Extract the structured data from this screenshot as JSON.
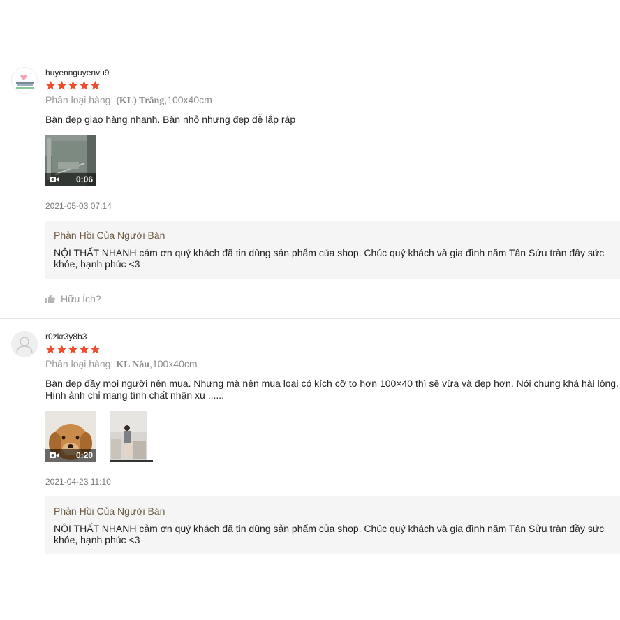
{
  "reviews": [
    {
      "username": "huyennguyenvu9",
      "rating": 5,
      "variant": {
        "label": "Phân loại hàng: ",
        "value": "(KL) Trắng",
        "size": ",100x40cm"
      },
      "comment": "Bàn đẹp giao hàng nhanh. Bàn nhỏ nhưng đẹp dễ lắp ráp",
      "media": [
        {
          "type": "video",
          "duration": "0:06"
        }
      ],
      "date": "2021-05-03 07:14",
      "reply": {
        "title": "Phản Hồi Của Người Bán",
        "text": "NỘI THẤT NHANH cảm ơn quý khách đã tin dùng sản phẩm của shop. Chúc quý khách và gia đình năm Tân Sửu tràn đầy sức khỏe, hạnh phúc <3"
      },
      "helpful_label": "Hữu Ích?"
    },
    {
      "username": "r0zkr3y8b3",
      "rating": 5,
      "variant": {
        "label": "Phân loại hàng: ",
        "value": "KL Nâu",
        "size": ",100x40cm"
      },
      "comment": "Bàn đẹp đầy mọi người nên mua. Nhưng mà nên mua loại có kích cỡ to hơn 100×40 thì sẽ vừa và đẹp hơn. Nói chung khá hài lòng. Hình ảnh chỉ mang tính chất nhận xu ......",
      "media": [
        {
          "type": "video",
          "duration": "0:20"
        },
        {
          "type": "image"
        }
      ],
      "date": "2021-04-23 11:10",
      "reply": {
        "title": "Phản Hồi Của Người Bán",
        "text": "NỘI THẤT NHANH cảm ơn quý khách đã tin dùng sản phẩm của shop. Chúc quý khách và gia đình năm Tân Sửu tràn đầy sức khỏe, hạnh phúc <3"
      }
    }
  ],
  "colors": {
    "star": "#ee4d2d",
    "reply_bg": "#f5f5f5",
    "reply_title": "#6d5a43",
    "muted": "#999999"
  },
  "icons": {
    "star": "star-icon",
    "video": "video-camera-icon",
    "helpful": "thumbs-up-icon",
    "avatar_default": "user-silhouette-icon"
  }
}
